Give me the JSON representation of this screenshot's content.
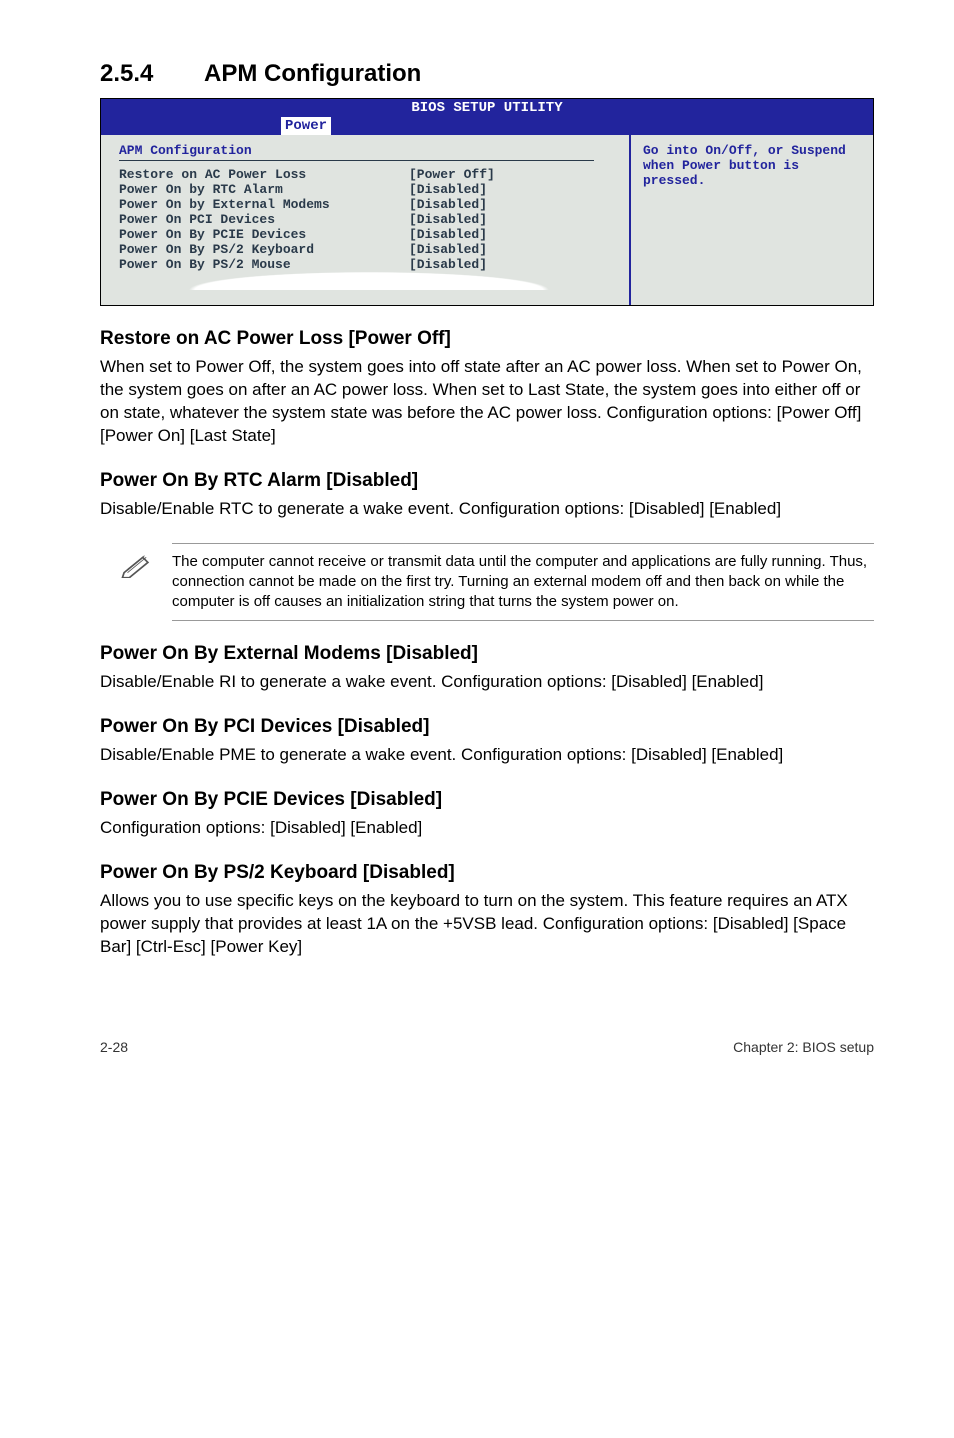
{
  "section": {
    "number": "2.5.4",
    "title": "APM Configuration"
  },
  "bios": {
    "utility_title": "BIOS SETUP UTILITY",
    "tab": "Power",
    "left_title": "APM Configuration",
    "rows": [
      {
        "key": "Restore on AC Power Loss",
        "val": "[Power Off]"
      },
      {
        "key": "Power On by RTC Alarm",
        "val": "[Disabled]"
      },
      {
        "key": "Power On by External Modems",
        "val": "[Disabled]"
      },
      {
        "key": "Power On PCI Devices",
        "val": "[Disabled]"
      },
      {
        "key": "Power On By PCIE Devices",
        "val": "[Disabled]"
      },
      {
        "key": "Power On By PS/2 Keyboard",
        "val": "[Disabled]"
      },
      {
        "key": "Power On By PS/2 Mouse",
        "val": "[Disabled]"
      }
    ],
    "help": "Go into On/Off, or Suspend when Power button is pressed."
  },
  "items": [
    {
      "heading": "Restore on AC Power Loss [Power Off]",
      "body": "When set to Power Off, the system goes into off state after an AC power loss. When set to Power On, the system goes on after an AC power loss. When set to Last State, the system goes into either off or on state, whatever the system state was before the AC power loss. Configuration options: [Power Off] [Power On] [Last State]"
    },
    {
      "heading": "Power On By RTC Alarm [Disabled]",
      "body": "Disable/Enable RTC to generate a wake event. Configuration options: [Disabled] [Enabled]"
    }
  ],
  "note": "The computer cannot receive or transmit data until the computer and applications are fully running. Thus, connection cannot be made on the first try. Turning an external modem off and then back on while the computer is off causes an initialization string that turns the system power on.",
  "items2": [
    {
      "heading": "Power On By External Modems [Disabled]",
      "body": "Disable/Enable RI to generate a wake event. Configuration options: [Disabled] [Enabled]"
    },
    {
      "heading": "Power On By PCI Devices [Disabled]",
      "body": "Disable/Enable PME to generate a wake event.  Configuration options: [Disabled] [Enabled]"
    },
    {
      "heading": "Power On By PCIE Devices [Disabled]",
      "body": "Configuration options: [Disabled] [Enabled]"
    },
    {
      "heading": "Power On By PS/2 Keyboard [Disabled]",
      "body": "Allows you to use specific keys on the keyboard to turn on the system. This feature requires an ATX power supply that provides at least 1A on the +5VSB lead. Configuration options: [Disabled] [Space Bar] [Ctrl-Esc] [Power Key]"
    }
  ],
  "footer": {
    "left": "2-28",
    "right": "Chapter 2: BIOS setup"
  }
}
